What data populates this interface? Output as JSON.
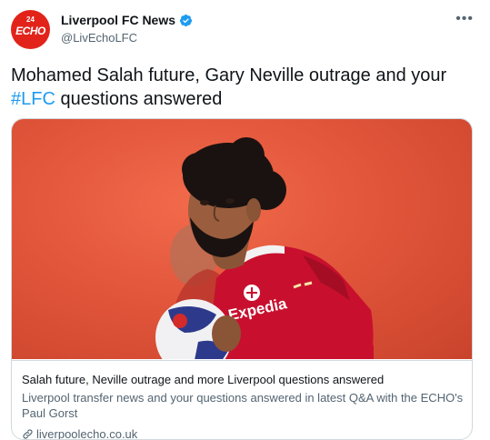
{
  "account": {
    "name": "Liverpool FC News",
    "handle": "@LivEchoLFC",
    "avatar_text": "ECHO",
    "avatar_small": "24",
    "verified": true
  },
  "tweet": {
    "text_part1": "Mohamed Salah future, Gary Neville outrage and your ",
    "hashtag": "#LFC",
    "text_part2": " questions answered"
  },
  "card": {
    "title": "Salah future, Neville outrage and more Liverpool questions answered",
    "description": "Liverpool transfer news and your questions answered in latest Q&A with the ECHO's Paul Gorst",
    "domain": "liverpoolecho.co.uk",
    "image_shirt_sponsor": "Expedia"
  },
  "colors": {
    "accent": "#1d9bf0",
    "avatar": "#e2231a",
    "background_image": "#e2563b"
  },
  "icons": [
    "more-options-icon",
    "verified-badge-icon",
    "link-icon"
  ]
}
